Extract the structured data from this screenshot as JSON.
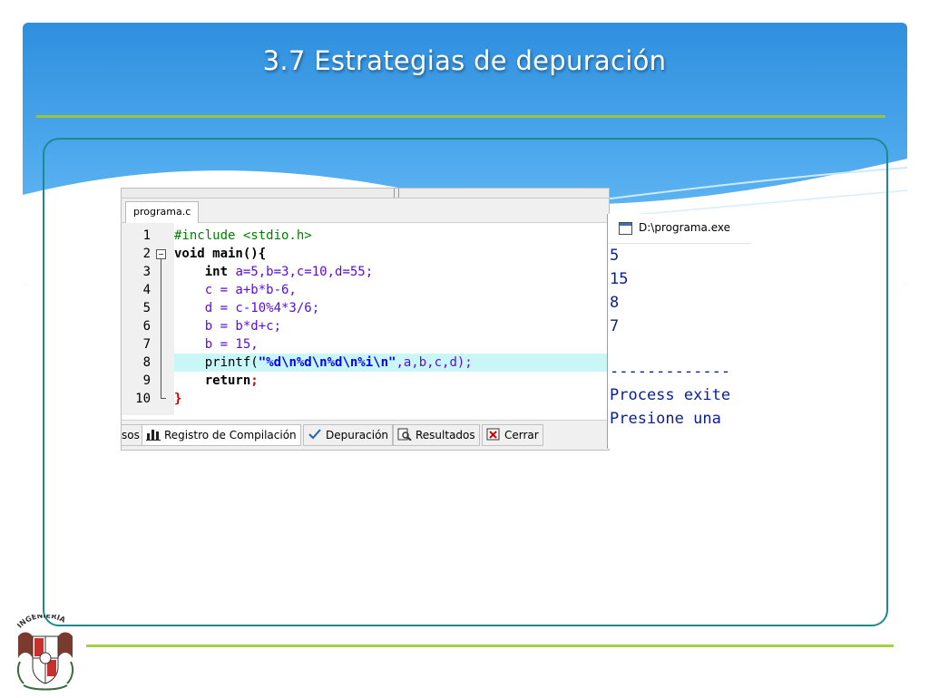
{
  "slide": {
    "title": "3.7  Estrategias de depuración",
    "logo_text": "INGENIERIA"
  },
  "ide": {
    "file_tab": "programa.c",
    "line_numbers": [
      "1",
      "2",
      "3",
      "4",
      "5",
      "6",
      "7",
      "8",
      "9",
      "10"
    ],
    "code": {
      "l1": "#include <stdio.h>",
      "l2_kw": "void",
      "l2_rest": " main(){",
      "l3_kw": "int",
      "l3_rest": " a=5,b=3,c=10,d=55;",
      "l4": "c = a+b*b-6,",
      "l5": "d = c-10%4*3/6;",
      "l6": "b = b*d+c;",
      "l7": "b = 15,",
      "l8_fn": "printf(",
      "l8_str": "\"%d\\n%d\\n%d\\n%i\\n\"",
      "l8_rest": ",a,b,c,d);",
      "l9_kw": "return",
      "l9_rest": ";",
      "l10": "}"
    },
    "bottom_tabs": {
      "partial": "sos",
      "compile_log": "Registro de Compilación",
      "debug": "Depuración",
      "results": "Resultados",
      "close": "Cerrar"
    }
  },
  "console": {
    "title": "D:\\programa.exe",
    "lines": [
      "5",
      "15",
      "8",
      "7",
      "",
      "-------------",
      "Process exite",
      "Presione una "
    ]
  },
  "colors": {
    "header_blue": "#3a9ae6",
    "accent_green": "#9bc43d",
    "box_border": "#1f8a8a",
    "highlight_line": "#c9f7f8",
    "console_text": "#0a1f8f"
  }
}
